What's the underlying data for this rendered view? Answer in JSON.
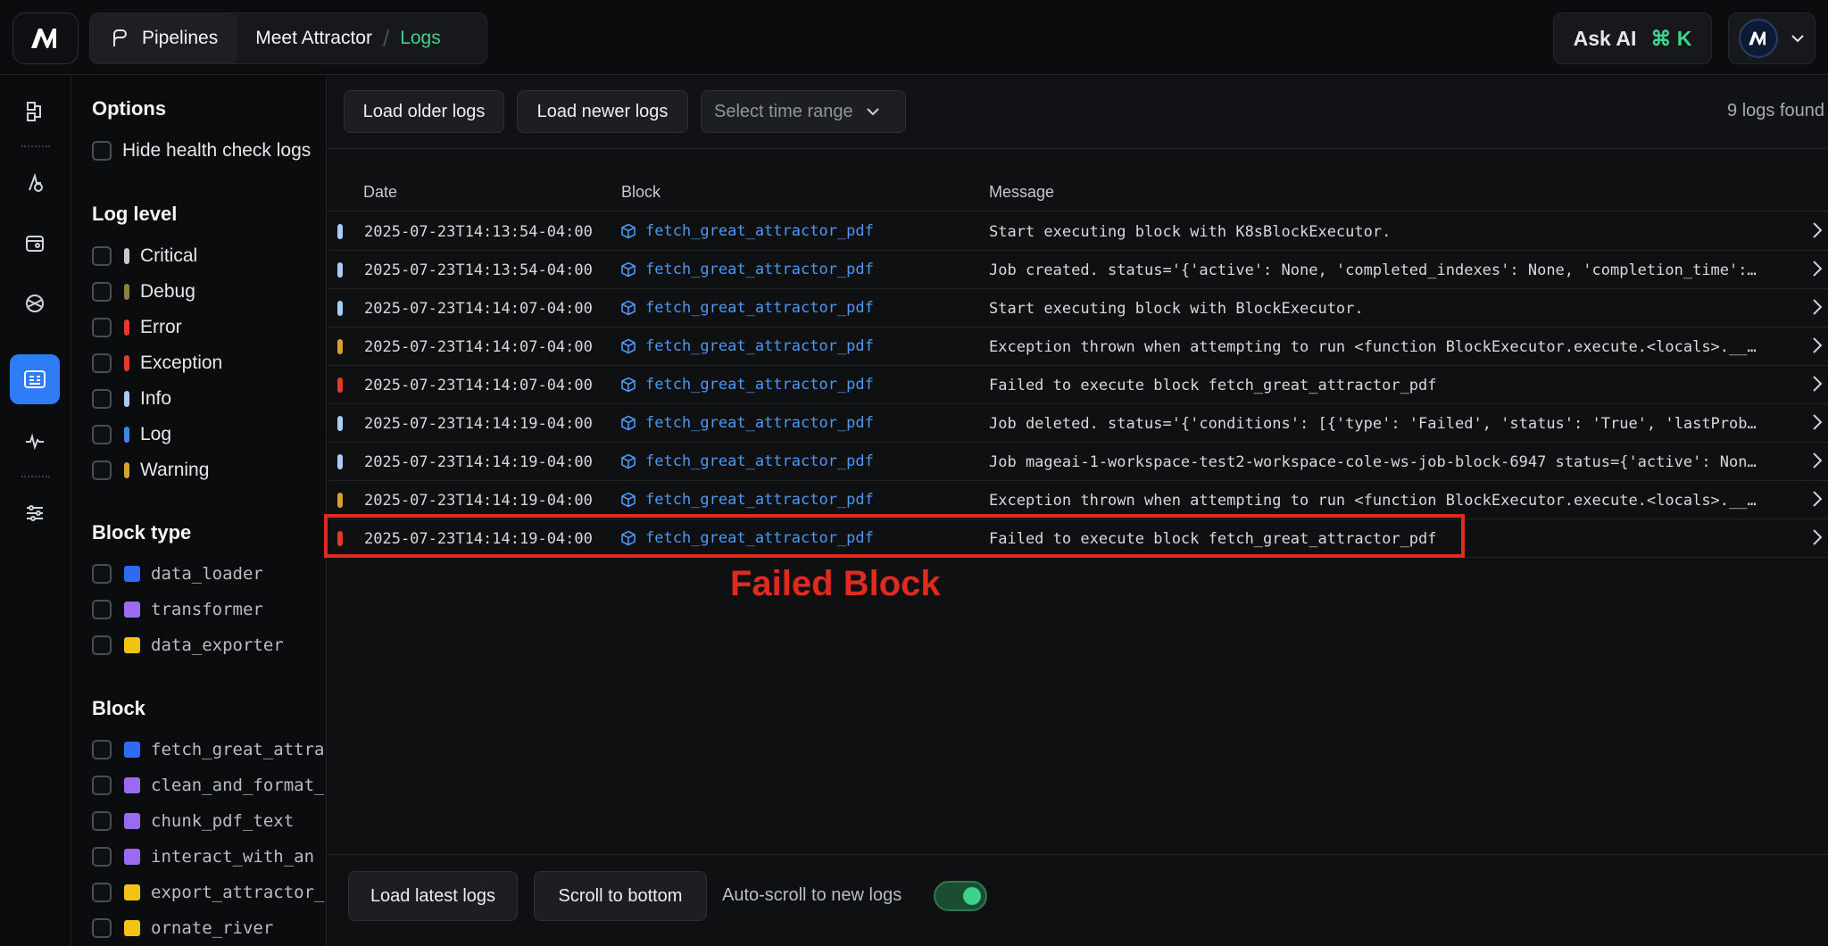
{
  "topbar": {
    "breadcrumb": {
      "pipelines": "Pipelines",
      "project": "Meet Attractor",
      "separator": "/",
      "current": "Logs"
    },
    "ask_ai": {
      "label": "Ask AI",
      "shortcut": "⌘ K"
    }
  },
  "rail": {
    "items": [
      "pipelines-icon",
      "triggers-icon",
      "blocks-icon",
      "globe-icon",
      "logs-icon",
      "monitor-icon",
      "settings-icon"
    ],
    "active": "logs-icon"
  },
  "options": {
    "title": "Options",
    "hide_health": "Hide health check logs",
    "log_level_title": "Log level",
    "log_levels": [
      {
        "label": "Critical",
        "color": "#c8c9cc"
      },
      {
        "label": "Debug",
        "color": "#8f7d3a"
      },
      {
        "label": "Error",
        "color": "#e5392e"
      },
      {
        "label": "Exception",
        "color": "#e5392e"
      },
      {
        "label": "Info",
        "color": "#a9ccf5"
      },
      {
        "label": "Log",
        "color": "#3f86e6"
      },
      {
        "label": "Warning",
        "color": "#d4a32b"
      }
    ],
    "block_type_title": "Block type",
    "block_types": [
      {
        "label": "data_loader",
        "color": "#2f6bf2"
      },
      {
        "label": "transformer",
        "color": "#9a6bf0"
      },
      {
        "label": "data_exporter",
        "color": "#f3c313"
      }
    ],
    "block_title": "Block",
    "blocks": [
      {
        "label": "fetch_great_attra",
        "color": "#2f6bf2"
      },
      {
        "label": "clean_and_format_",
        "color": "#9a6bf0"
      },
      {
        "label": "chunk_pdf_text",
        "color": "#9a6bf0"
      },
      {
        "label": "interact_with_an",
        "color": "#9a6bf0"
      },
      {
        "label": "export_attractor_",
        "color": "#f3c313"
      },
      {
        "label": "ornate_river",
        "color": "#f3c313"
      }
    ]
  },
  "toolbar": {
    "load_older": "Load older logs",
    "load_newer": "Load newer logs",
    "time_range_placeholder": "Select time range",
    "count": "9 logs found"
  },
  "table": {
    "headers": {
      "date": "Date",
      "block": "Block",
      "message": "Message"
    },
    "rows": [
      {
        "level_color": "#a9ccf5",
        "date": "2025-07-23T14:13:54-04:00",
        "block": "fetch_great_attractor_pdf",
        "message": "Start executing block with K8sBlockExecutor."
      },
      {
        "level_color": "#a9ccf5",
        "date": "2025-07-23T14:13:54-04:00",
        "block": "fetch_great_attractor_pdf",
        "message": "Job created. status='{'active': None, 'completed_indexes': None, 'completion_time':…"
      },
      {
        "level_color": "#a9ccf5",
        "date": "2025-07-23T14:14:07-04:00",
        "block": "fetch_great_attractor_pdf",
        "message": "Start executing block with BlockExecutor."
      },
      {
        "level_color": "#d4a32b",
        "date": "2025-07-23T14:14:07-04:00",
        "block": "fetch_great_attractor_pdf",
        "message": "Exception thrown when attempting to run <function BlockExecutor.execute.<locals>.__…"
      },
      {
        "level_color": "#e5392e",
        "date": "2025-07-23T14:14:07-04:00",
        "block": "fetch_great_attractor_pdf",
        "message": "Failed to execute block fetch_great_attractor_pdf"
      },
      {
        "level_color": "#a9ccf5",
        "date": "2025-07-23T14:14:19-04:00",
        "block": "fetch_great_attractor_pdf",
        "message": "Job deleted. status='{'conditions': [{'type': 'Failed', 'status': 'True', 'lastProb…"
      },
      {
        "level_color": "#a9ccf5",
        "date": "2025-07-23T14:14:19-04:00",
        "block": "fetch_great_attractor_pdf",
        "message": "Job mageai-1-workspace-test2-workspace-cole-ws-job-block-6947 status={'active': Non…"
      },
      {
        "level_color": "#d4a32b",
        "date": "2025-07-23T14:14:19-04:00",
        "block": "fetch_great_attractor_pdf",
        "message": "Exception thrown when attempting to run <function BlockExecutor.execute.<locals>.__…"
      },
      {
        "level_color": "#e5392e",
        "date": "2025-07-23T14:14:19-04:00",
        "block": "fetch_great_attractor_pdf",
        "message": "Failed to execute block fetch_great_attractor_pdf"
      }
    ]
  },
  "annotation": {
    "label": "Failed Block",
    "color": "#e0291f"
  },
  "footer": {
    "load_latest": "Load latest logs",
    "scroll_bottom": "Scroll to bottom",
    "auto_scroll": "Auto-scroll to new logs",
    "auto_scroll_on": true
  },
  "colors": {
    "accent": "#2e7df6",
    "green": "#3ed28a",
    "link": "#4e97f2"
  }
}
